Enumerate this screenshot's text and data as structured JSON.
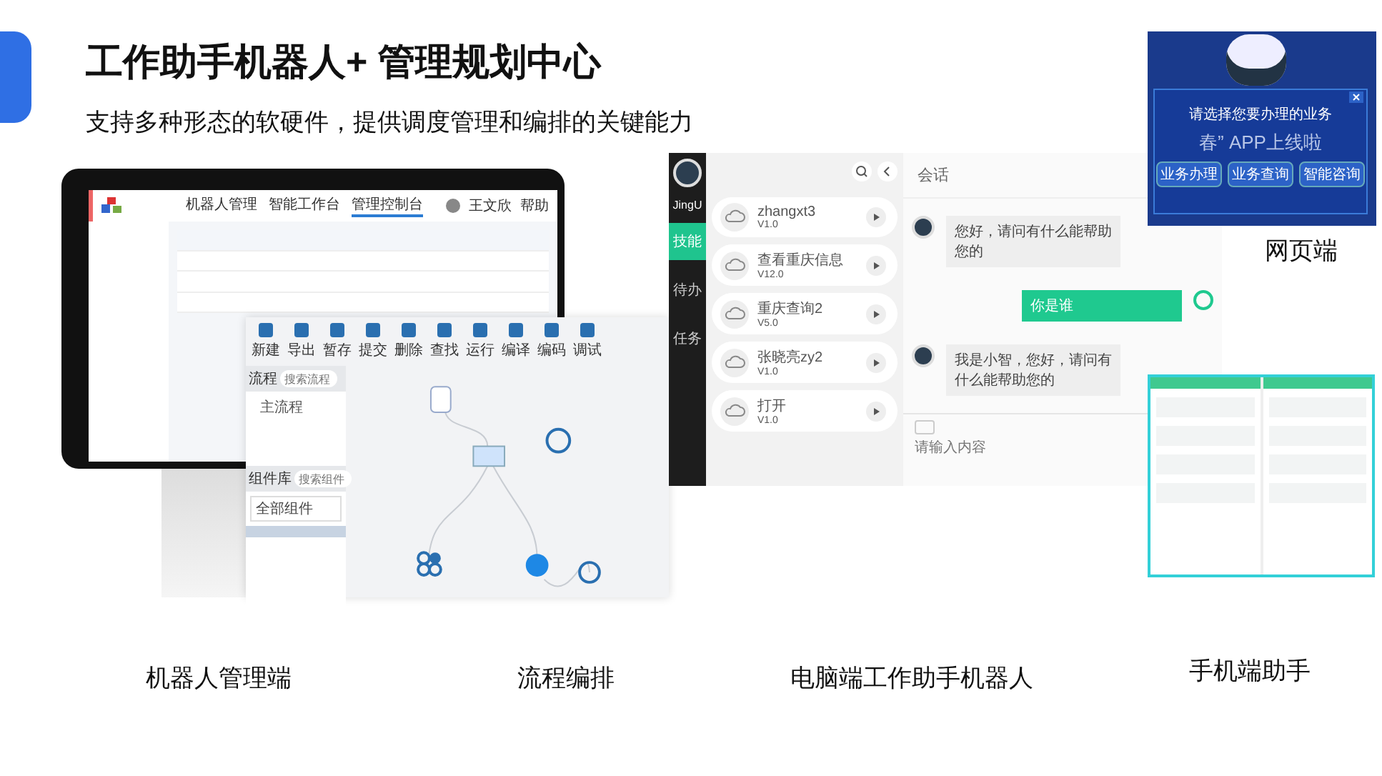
{
  "slide": {
    "title": "工作助手机器人+ 管理规划中心",
    "subtitle": "支持多种形态的软硬件，提供调度管理和编排的关键能力"
  },
  "robot_console": {
    "nav_tabs": [
      {
        "label": "机器人管理",
        "selected": false
      },
      {
        "label": "智能工作台",
        "selected": false
      },
      {
        "label": "管理控制台",
        "selected": true
      }
    ],
    "user": "王文欣",
    "help": "帮助"
  },
  "flow_editor": {
    "toolbar": [
      "新建",
      "导出",
      "暂存",
      "提交",
      "删除",
      "查找",
      "运行",
      "编译",
      "编码",
      "调试"
    ],
    "flow_label": "流程",
    "flow_search_placeholder": "搜索流程",
    "main_flow": "主流程",
    "library_label": "组件库",
    "library_search_placeholder": "搜索组件",
    "library_filter": "全部组件"
  },
  "desktop_assistant": {
    "app_name": "JingU",
    "nav": [
      {
        "label": "技能",
        "selected": true
      },
      {
        "label": "待办",
        "selected": false
      },
      {
        "label": "任务",
        "selected": false
      }
    ],
    "skills": [
      {
        "name": "zhangxt3",
        "version": "V1.0"
      },
      {
        "name": "查看重庆信息",
        "version": "V12.0"
      },
      {
        "name": "重庆查询2",
        "version": "V5.0"
      },
      {
        "name": "张晓亮zy2",
        "version": "V1.0"
      },
      {
        "name": "打开",
        "version": "V1.0"
      }
    ],
    "chat_title": "会话",
    "messages": [
      {
        "kind": "bot",
        "text": "您好，请问有什么能帮助您的"
      },
      {
        "kind": "user",
        "text": "你是谁"
      },
      {
        "kind": "bot",
        "text": "我是小智，您好，请问有什么能帮助您的"
      }
    ],
    "input_placeholder": "请输入内容"
  },
  "web_client": {
    "background_text": "春” APP上线啦",
    "prompt": "请选择您要办理的业务",
    "buttons": [
      "业务办理",
      "业务查询",
      "智能咨询"
    ]
  },
  "captions": {
    "web": "网页端",
    "console": "机器人管理端",
    "flow": "流程编排",
    "desktop": "电脑端工作助手机器人",
    "mobile": "手机端助手"
  }
}
